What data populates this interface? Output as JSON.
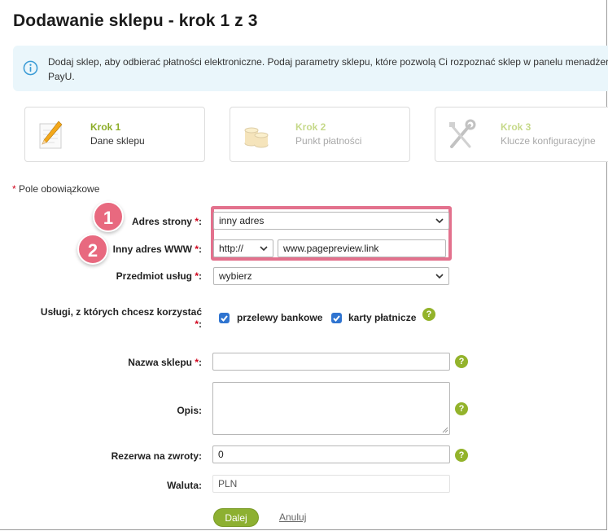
{
  "page": {
    "title": "Dodawanie sklepu - krok 1 z 3"
  },
  "info": {
    "text": "Dodaj sklep, aby odbierać płatności elektroniczne. Podaj parametry sklepu, które pozwolą Ci rozpoznać sklep w panelu menadżera\nPayU.",
    "icon": "info-icon"
  },
  "steps": [
    {
      "num": "Krok 1",
      "label": "Dane sklepu",
      "icon": "pencil-document-icon",
      "state": "active"
    },
    {
      "num": "Krok 2",
      "label": "Punkt płatności",
      "icon": "coins-icon",
      "state": "inactive"
    },
    {
      "num": "Krok 3",
      "label": "Klucze konfiguracyjne",
      "icon": "tools-icon",
      "state": "inactive"
    }
  ],
  "required_note": {
    "star": "*",
    "text": " Pole obowiązkowe"
  },
  "form": {
    "address": {
      "label": "Adres strony",
      "star": "*",
      "colon": ":",
      "value": "inny adres"
    },
    "other_url": {
      "label": "Inny adres WWW",
      "star": "*",
      "colon": ":",
      "protocol": "http://",
      "value": "www.pagepreview.link"
    },
    "subject": {
      "label": "Przedmiot usług",
      "star": "*",
      "colon": ":",
      "value": "wybierz"
    },
    "services": {
      "label": "Usługi, z których chcesz korzystać",
      "star": "*",
      "colon": ":",
      "options": [
        {
          "label": "przelewy bankowe",
          "checked": true
        },
        {
          "label": "karty płatnicze",
          "checked": true
        }
      ]
    },
    "shop_name": {
      "label": "Nazwa sklepu",
      "star": "*",
      "colon": ":",
      "value": ""
    },
    "description": {
      "label": "Opis:",
      "value": ""
    },
    "refund_reserve": {
      "label": "Rezerwa na zwroty:",
      "value": "0"
    },
    "currency": {
      "label": "Waluta:",
      "value": "PLN"
    }
  },
  "annotations": {
    "badge1": "1",
    "badge2": "2"
  },
  "help_glyph": "?",
  "actions": {
    "next": "Dalej",
    "cancel": "Anuluj"
  },
  "colors": {
    "accent_green": "#8db031",
    "info_bg": "#eaf6fb",
    "highlight": "#e3718d",
    "required_star": "#d0021b",
    "checkbox_blue": "#2f74d0"
  }
}
